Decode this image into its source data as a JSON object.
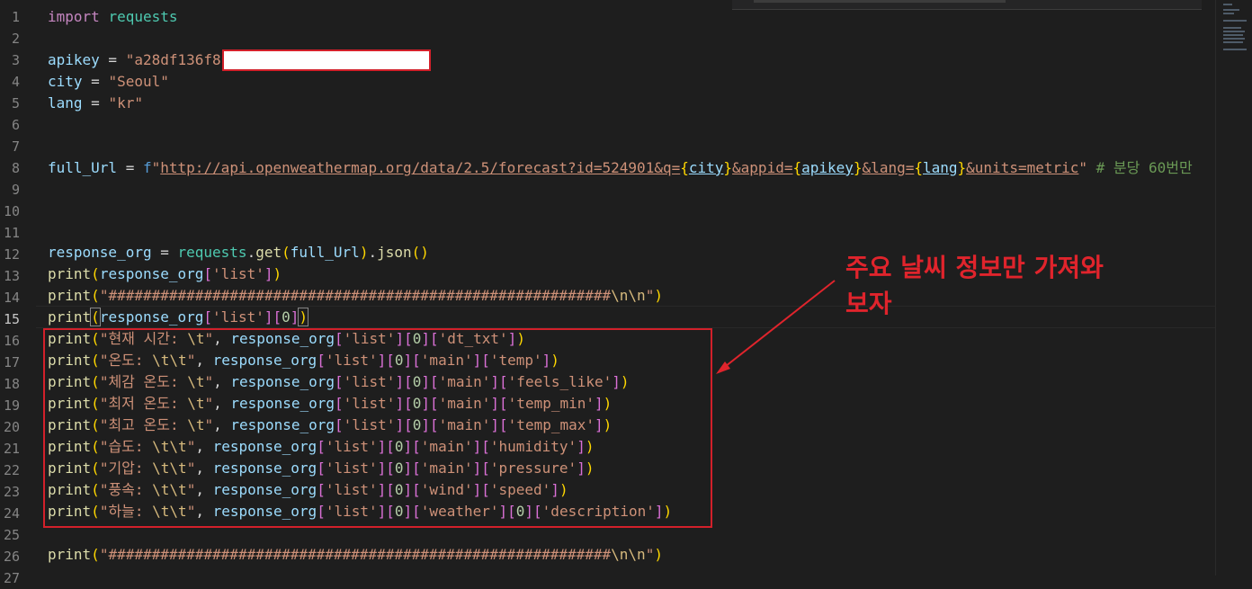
{
  "editor": {
    "line_numbers": [
      "1",
      "2",
      "3",
      "4",
      "5",
      "6",
      "7",
      "8",
      "9",
      "10",
      "11",
      "12",
      "13",
      "14",
      "15",
      "16",
      "17",
      "18",
      "19",
      "20",
      "21",
      "22",
      "23",
      "24",
      "25",
      "26",
      "27"
    ],
    "active_line": "15",
    "code": {
      "l1_kw": "import",
      "l1_mod": "requests",
      "l3_var": "apikey",
      "l3_eq": " = ",
      "l3_str": "\"a28df136f8",
      "l4_var": "city",
      "l4_eq": " = ",
      "l4_str": "\"Seoul\"",
      "l5_var": "lang",
      "l5_eq": " = ",
      "l5_str": "\"kr\"",
      "l8_var": "full_Url",
      "l8_eq": " = ",
      "l8_f": "f",
      "l8_q": "\"",
      "l8_url1": "http://api.openweathermap.org/data/2.5/forecast?id=524901&q=",
      "l8_ob1": "{",
      "l8_city": "city",
      "l8_cb1": "}",
      "l8_url2": "&appid=",
      "l8_ob2": "{",
      "l8_apikey": "apikey",
      "l8_cb2": "}",
      "l8_url3": "&lang=",
      "l8_ob3": "{",
      "l8_lang": "lang",
      "l8_cb3": "}",
      "l8_url4": "&units=metric",
      "l8_q2": "\"",
      "l8_cmt": " # 분당 60번만 ",
      "l12_var": "response_org",
      "l12_eq": " = ",
      "l12_mod": "requests",
      "l12_dot": ".",
      "l12_fn": "get",
      "l12_p1": "(",
      "l12_arg": "full_Url",
      "l12_p2": ")",
      "l12_dot2": ".",
      "l12_fn2": "json",
      "l12_p3": "()",
      "print": "print",
      "resp": "response_org",
      "l13_str": "'list'",
      "l14_str": "\"##########################################################",
      "l14_esc": "\\n\\n",
      "l14_q": "\"",
      "l15_zero": "0",
      "r16": "\"현재 시간: ",
      "r17": "\"온도: ",
      "r18": "\"체감 온도: ",
      "r19": "\"최저 온도: ",
      "r20": "\"최고 온도: ",
      "r21": "\"습도: ",
      "r22": "\"기압: ",
      "r23": "\"풍속: ",
      "r24": "\"하늘: ",
      "esc_t": "\\t",
      "esc_tt": "\\t\\t",
      "k_list": "'list'",
      "k_main": "'main'",
      "k_dt": "'dt_txt'",
      "k_temp": "'temp'",
      "k_feels": "'feels_like'",
      "k_min": "'temp_min'",
      "k_max": "'temp_max'",
      "k_hum": "'humidity'",
      "k_pres": "'pressure'",
      "k_wind": "'wind'",
      "k_speed": "'speed'",
      "k_weather": "'weather'",
      "k_desc": "'description'"
    }
  },
  "annotation": {
    "line1": "주요 날씨 정보만 가져와",
    "line2": "보자"
  },
  "colors": {
    "annotation_red": "#e0242c",
    "background": "#1e1e1e"
  }
}
